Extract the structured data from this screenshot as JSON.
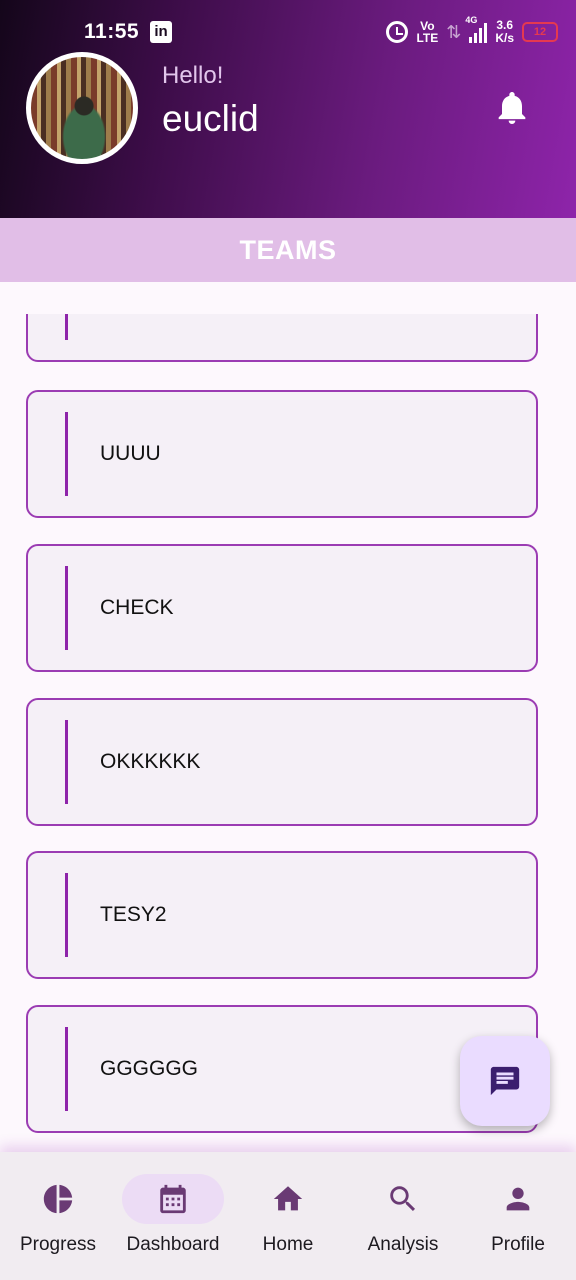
{
  "status_bar": {
    "time": "11:55",
    "app_badge": "in",
    "volte_top": "Vo",
    "volte_bottom": "LTE",
    "network": "4G",
    "speed_value": "3.6",
    "speed_unit": "K/s",
    "battery": "12"
  },
  "header": {
    "greeting": "Hello!",
    "username": "euclid"
  },
  "section": {
    "title": "TEAMS"
  },
  "teams": [
    {
      "name": ""
    },
    {
      "name": "UUUU"
    },
    {
      "name": "CHECK"
    },
    {
      "name": "OKKKKKK"
    },
    {
      "name": "TESY2"
    },
    {
      "name": "GGGGGG"
    }
  ],
  "fab": {
    "icon": "chat-icon"
  },
  "nav": {
    "items": [
      {
        "label": "Progress",
        "icon": "pie-chart-icon"
      },
      {
        "label": "Dashboard",
        "icon": "calendar-icon"
      },
      {
        "label": "Home",
        "icon": "home-icon"
      },
      {
        "label": "Analysis",
        "icon": "search-icon"
      },
      {
        "label": "Profile",
        "icon": "person-icon"
      }
    ],
    "active": "Dashboard"
  },
  "colors": {
    "accent": "#8e24aa",
    "header_gradient_start": "#14061a",
    "header_gradient_end": "#8e24aa",
    "teams_bar": "#e1bee7",
    "card_border": "#9b3cb3",
    "fab_bg": "#eadcff",
    "nav_icon": "#6a3a74"
  }
}
